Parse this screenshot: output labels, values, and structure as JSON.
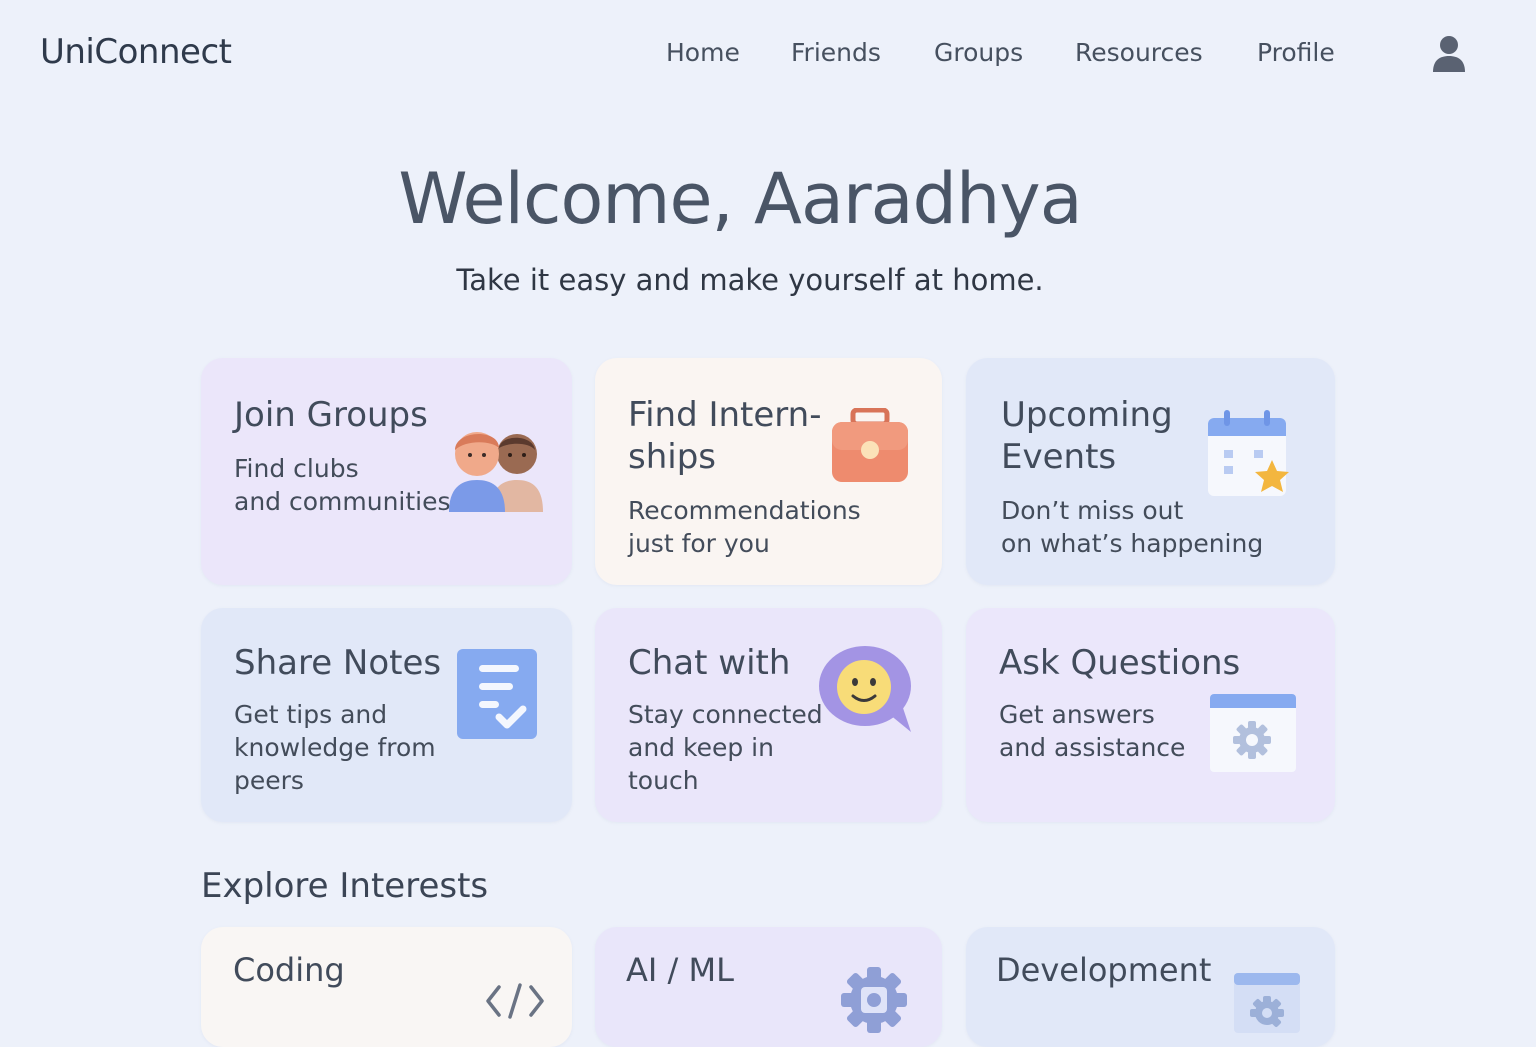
{
  "app": {
    "name": "UniConnect"
  },
  "nav": {
    "items": [
      {
        "label": "Home"
      },
      {
        "label": "Friends"
      },
      {
        "label": "Groups"
      },
      {
        "label": "Resources"
      },
      {
        "label": "Profile"
      }
    ],
    "avatar_icon": "user-icon"
  },
  "hero": {
    "title": "Welcome, Aaradhya",
    "subtitle": "Take it easy and make yourself at home."
  },
  "cards": [
    {
      "title": "Join Groups",
      "desc": [
        "Find clubs",
        "and communities"
      ],
      "icon": "people-icon",
      "bg": "#ebe6fa"
    },
    {
      "title": [
        "Find Intern-",
        "ships"
      ],
      "desc": [
        "Recommendations",
        "just for you"
      ],
      "icon": "briefcase-icon",
      "bg": "#faf5f2"
    },
    {
      "title": [
        "Upcoming",
        "Events"
      ],
      "desc": [
        "Don’t miss out",
        "on what’s happening"
      ],
      "icon": "calendar-icon",
      "bg": "#e1e8f8"
    },
    {
      "title": "Share Notes",
      "desc": [
        "Get tips and",
        "knowledge from",
        "peers"
      ],
      "icon": "notes-icon",
      "bg": "#e1e8f8"
    },
    {
      "title": "Chat with",
      "desc": [
        "Stay connected",
        "and keep in",
        "touch"
      ],
      "icon": "chat-icon",
      "bg": "#eae6fa"
    },
    {
      "title": "Ask Questions",
      "desc": [
        "Get answers",
        "and assistance"
      ],
      "icon": "settings-window-icon",
      "bg": "#ebe7fb"
    }
  ],
  "interests": {
    "heading": "Explore Interests",
    "items": [
      {
        "title": "Coding",
        "icon": "code-icon",
        "bg": "#f9f6f4"
      },
      {
        "title": "AI / ML",
        "icon": "gear-icon",
        "bg": "#e9e6fa"
      },
      {
        "title": "Development",
        "icon": "settings-window-icon",
        "bg": "#e1e8f8"
      }
    ]
  },
  "colors": {
    "background": "#edf1fa",
    "text": "#3e4858",
    "accent_blue": "#7ea6ef",
    "accent_orange": "#ef8a6c",
    "accent_purple": "#a89ae6"
  }
}
